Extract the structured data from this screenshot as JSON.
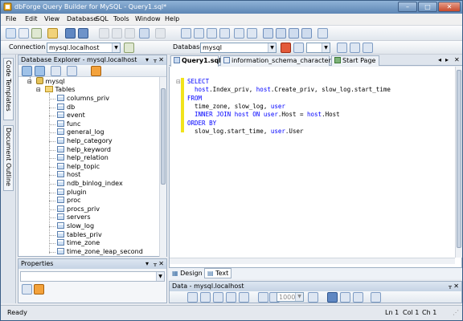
{
  "window": {
    "title": "dbForge Query Builder for MySQL - Query1.sql*"
  },
  "menu": [
    "File",
    "Edit",
    "View",
    "Database",
    "SQL",
    "Tools",
    "Window",
    "Help"
  ],
  "connection_bar": {
    "label": "Connection",
    "value": "mysql.localhost",
    "db_label": "Database",
    "db_value": "mysql"
  },
  "side_tabs": [
    "Code Templates",
    "Document Outline"
  ],
  "explorer": {
    "title": "Database Explorer - mysql.localhost",
    "db": "mysql",
    "folder": "Tables",
    "tables": [
      "columns_priv",
      "db",
      "event",
      "func",
      "general_log",
      "help_category",
      "help_keyword",
      "help_relation",
      "help_topic",
      "host",
      "ndb_binlog_index",
      "plugin",
      "proc",
      "procs_priv",
      "servers",
      "slow_log",
      "tables_priv",
      "time_zone",
      "time_zone_leap_second"
    ]
  },
  "properties": {
    "title": "Properties"
  },
  "tabs": [
    {
      "label": "Query1.sql*"
    },
    {
      "label": "information_schema_character_sets"
    },
    {
      "label": "Start Page"
    }
  ],
  "editor": {
    "lines": [
      {
        "kw": "SELECT",
        "rest": ""
      },
      {
        "kw": "",
        "rest": "  host.Index_priv, host.Create_priv, slow_log.start_time"
      },
      {
        "kw": "FROM",
        "rest": ""
      },
      {
        "kw": "",
        "rest": "  time_zone, slow_log, user"
      },
      {
        "kw": "",
        "rest": "  INNER JOIN host ON user.Host = host.Host"
      },
      {
        "kw": "ORDER BY",
        "rest": ""
      },
      {
        "kw": "",
        "rest": "  slow_log.start_time, user.User"
      }
    ]
  },
  "bottom_tabs": {
    "design": "Design",
    "text": "Text"
  },
  "data_pane": {
    "title": "Data - mysql.localhost",
    "limit": "1000"
  },
  "status": {
    "left": "Ready",
    "ln": "Ln 1",
    "col": "Col 1",
    "ch": "Ch 1"
  }
}
